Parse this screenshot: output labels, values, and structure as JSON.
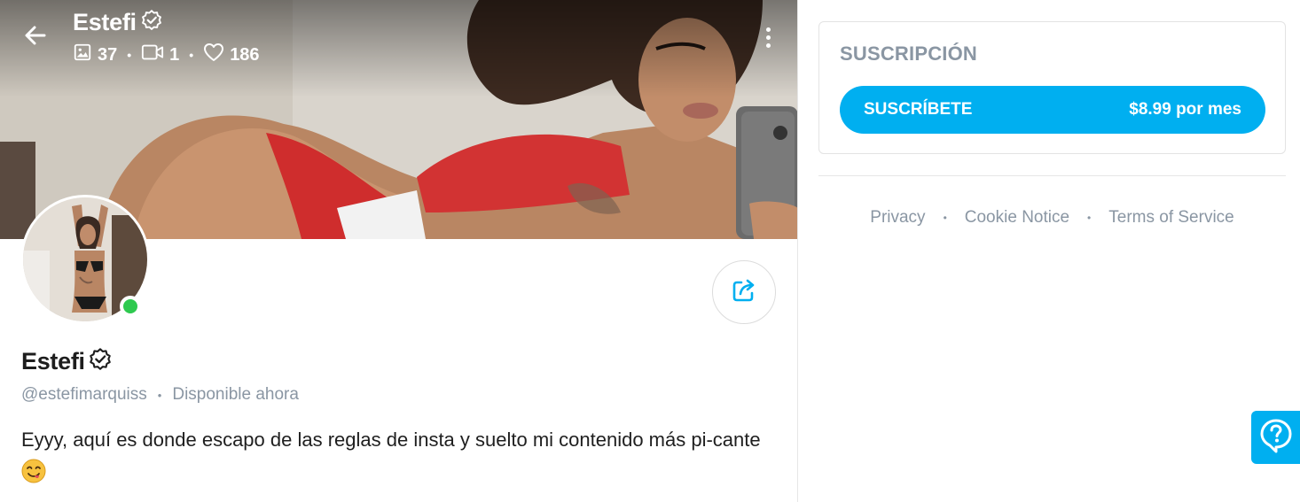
{
  "header": {
    "name": "Estefi",
    "stats": {
      "photos": "37",
      "videos": "1",
      "likes": "186"
    }
  },
  "profile": {
    "name": "Estefi",
    "handle": "@estefimarquiss",
    "status": "Disponible ahora",
    "bio": "Eyyy, aquí es donde escapo de las reglas de insta y suelto mi contenido más pi-cante",
    "online": true
  },
  "subscription": {
    "title": "SUSCRIPCIÓN",
    "button_label": "SUSCRÍBETE",
    "price": "$8.99 por mes"
  },
  "footer": {
    "links": [
      "Privacy",
      "Cookie Notice",
      "Terms of Service"
    ]
  },
  "colors": {
    "accent": "#00aff0",
    "online": "#2ec94f",
    "muted": "#8a96a3"
  },
  "icons": [
    "back-arrow-icon",
    "verified-badge-icon",
    "image-icon",
    "video-icon",
    "heart-icon",
    "more-vertical-icon",
    "share-icon",
    "help-icon",
    "emoji-yum-icon"
  ]
}
